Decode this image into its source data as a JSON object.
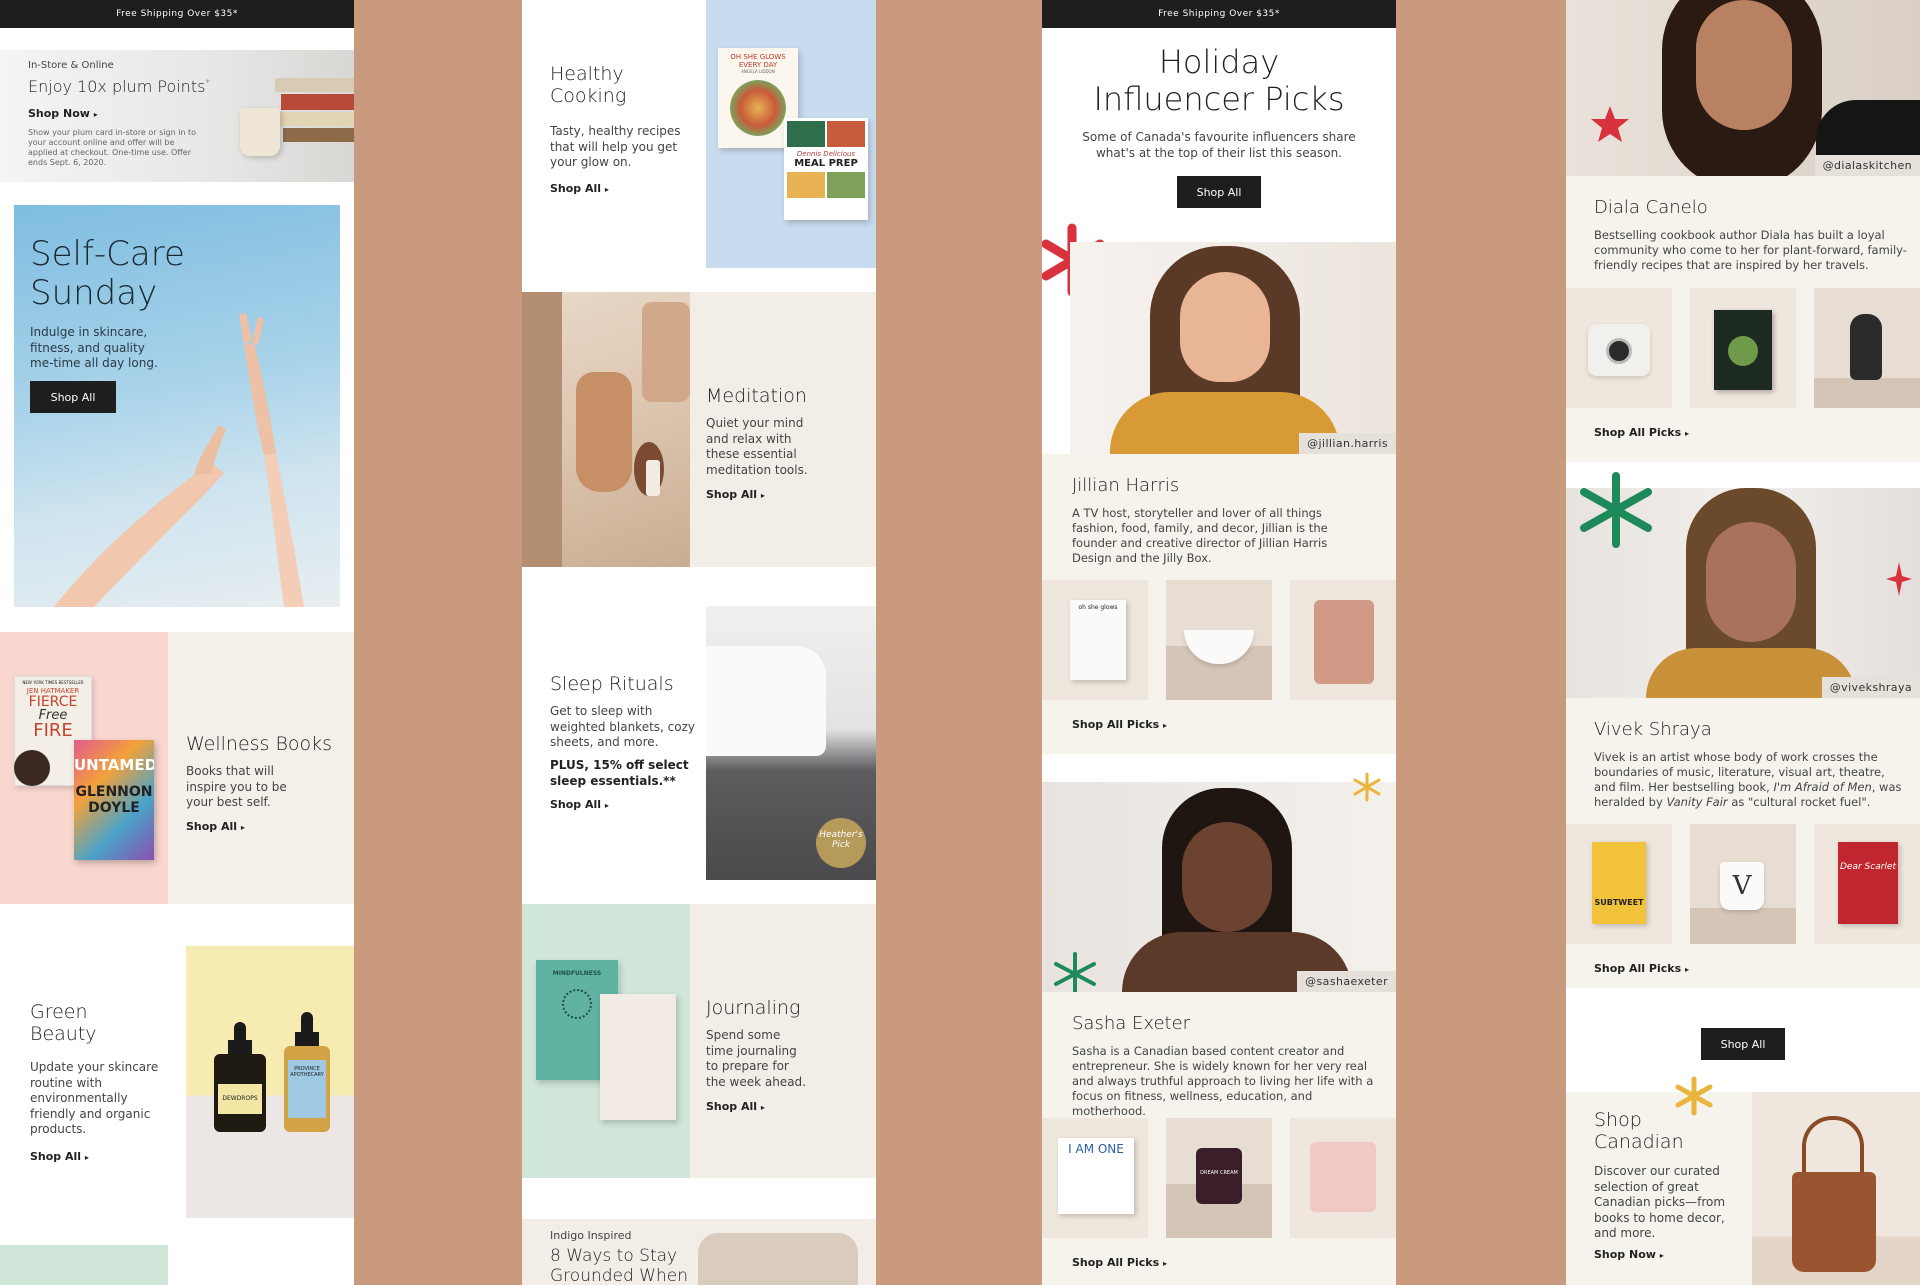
{
  "colors": {
    "background": "#c99a7e",
    "dark": "#1e1e1e",
    "cream": "#f6f2ec",
    "beige": "#ece3dc",
    "pink": "#f9d7cf",
    "sky": "#8fc4e3",
    "mint": "#cfe6d8",
    "red": "#d9323f",
    "green": "#1e8a5a",
    "gold": "#e9b53c"
  },
  "col1": {
    "bar": "Free Shipping Over $35*",
    "promo": {
      "eyebrow": "In-Store & Online",
      "title": "Enjoy 10x plum Points",
      "sup": "*",
      "link": "Shop Now",
      "fine": "Show your plum card in-store or sign in to your account online and offer will be applied at checkout. One-time use. Offer ends Sept. 6, 2020."
    },
    "selfcare": {
      "title1": "Self-Care",
      "title2": "Sunday",
      "body": "Indulge in skincare, fitness, and quality me-time all day long.",
      "button": "Shop All"
    },
    "wellness": {
      "title": "Wellness Books",
      "body": "Books that will inspire you to be your best self.",
      "link": "Shop All",
      "book1_top": "NEW YORK TIMES BESTSELLER",
      "book1_author": "JEN HATMAKER",
      "book1_title1": "FIERCE",
      "book1_title2": "Free",
      "book1_title3": "FIRE",
      "book2_title1": "UNTAMED",
      "book2_author1": "GLENNON",
      "book2_author2": "DOYLE"
    },
    "green": {
      "title1": "Green",
      "title2": "Beauty",
      "body": "Update your skincare routine with environmentally friendly and organic products.",
      "link": "Shop All",
      "bottle1": "DEWDROPS",
      "bottle2a": "PROVINCE",
      "bottle2b": "APOTHECARY"
    }
  },
  "col2": {
    "healthy": {
      "title1": "Healthy",
      "title2": "Cooking",
      "body": "Tasty, healthy recipes that will help you get your glow on.",
      "link": "Shop All",
      "book1a": "OH SHE GLOWS",
      "book1b": "EVERY DAY",
      "book1c": "ANGELA LIDDON",
      "book2a": "Dennis Delicious",
      "book2b": "MEAL PREP"
    },
    "meditation": {
      "title": "Meditation",
      "body": "Quiet your mind and relax with these essential meditation tools.",
      "link": "Shop All"
    },
    "sleep": {
      "title": "Sleep Rituals",
      "body": "Get to sleep with weighted blankets, cozy sheets, and more.",
      "plus": "PLUS, 15% off select sleep essentials.**",
      "link": "Shop All",
      "badge1": "Heather's",
      "badge2": "Pick"
    },
    "journal": {
      "title": "Journaling",
      "body": "Spend some time journaling to prepare for the week ahead.",
      "link": "Shop All",
      "cover": "MINDFULNESS"
    },
    "indigo": {
      "eyebrow": "Indigo Inspired",
      "title1": "8 Ways to Stay",
      "title2": "Grounded When"
    }
  },
  "col3": {
    "bar": "Free Shipping Over $35*",
    "title1": "Holiday",
    "title2": "Influencer Picks",
    "body": "Some of Canada's favourite influencers share what's at the top of their list this season.",
    "button": "Shop All",
    "p1": {
      "handle": "@jillian.harris",
      "name": "Jillian Harris",
      "bio": "A TV host, storyteller and lover of all things fashion, food, family, and decor, Jillian is the founder and creative director of Jillian Harris Design and the Jilly Box.",
      "link": "Shop All Picks",
      "book": "oh she glows"
    },
    "p2": {
      "handle": "@sashaexeter",
      "name": "Sasha Exeter",
      "bio": "Sasha is a Canadian based content creator and entrepreneur. She is widely known for her very real and always truthful approach to living her life with a focus on fitness, wellness, education, and motherhood.",
      "link": "Shop All Picks",
      "book": "I AM ONE",
      "jar": "DREAM CREAM"
    }
  },
  "col4": {
    "p1": {
      "handle": "@dialaskitchen",
      "name": "Diala Canelo",
      "bio": "Bestselling cookbook author Diala has built a loyal community who come to her for plant-forward, family-friendly recipes that are inspired by her travels.",
      "link": "Shop All Picks"
    },
    "p2": {
      "handle": "@vivekshraya",
      "name": "Vivek Shraya",
      "bio_a": "Vivek is an artist whose body of work crosses the boundaries of music, literature, visual art, theatre, and film. Her bestselling book,",
      "bio_b": "I'm Afraid of Men",
      "bio_c": ", was heralded by",
      "bio_d": "Vanity Fair",
      "bio_e": "as \"cultural rocket fuel\".",
      "link": "Shop All Picks",
      "book1": "SUBTWEET",
      "book2": "Dear Scarlet"
    },
    "button": "Shop All",
    "canadian": {
      "title1": "Shop",
      "title2": "Canadian",
      "body": "Discover our curated selection of great Canadian picks—from books to home decor, and more.",
      "link": "Shop Now"
    }
  }
}
